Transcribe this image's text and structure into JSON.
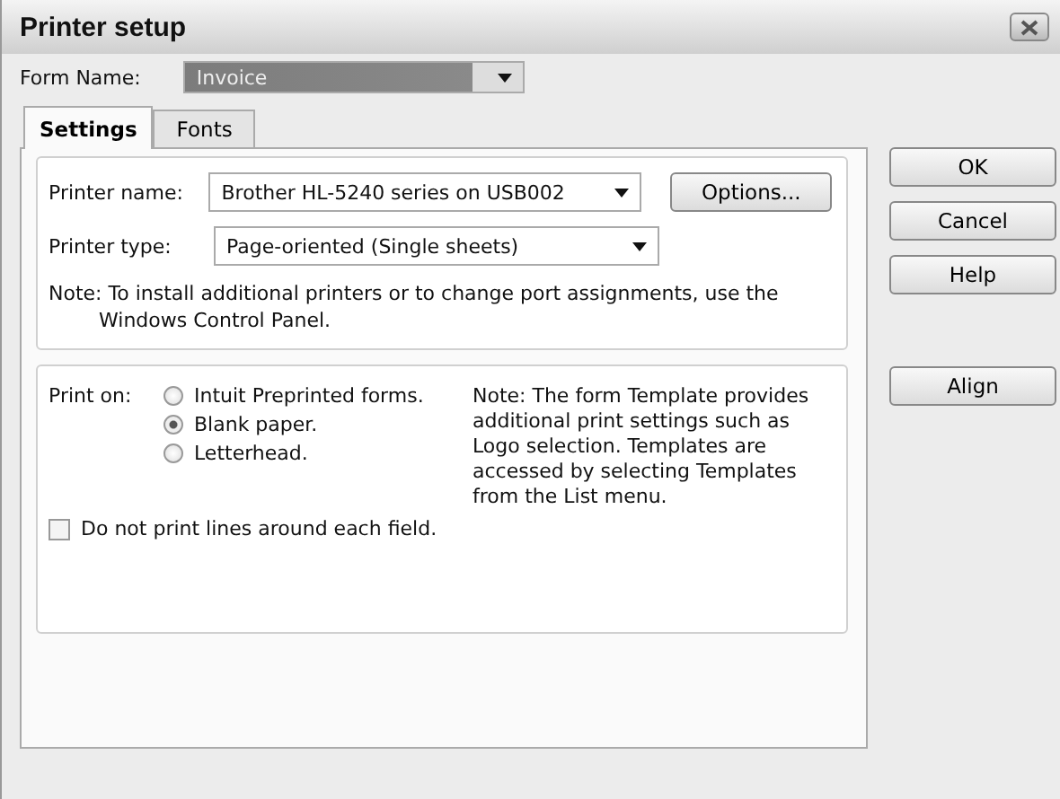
{
  "window": {
    "title": "Printer setup"
  },
  "form_name": {
    "label": "Form Name:",
    "value": "Invoice"
  },
  "tabs": [
    {
      "label": "Settings",
      "selected": true
    },
    {
      "label": "Fonts",
      "selected": false
    }
  ],
  "printer_name": {
    "label": "Printer name:",
    "value": "Brother HL-5240 series on USB002"
  },
  "options_button": "Options...",
  "printer_type": {
    "label": "Printer type:",
    "value": "Page-oriented (Single sheets)"
  },
  "printer_note": "Note: To install additional printers or to change port assignments, use the Windows Control Panel.",
  "print_on": {
    "label": "Print on:",
    "options": [
      {
        "label": "Intuit Preprinted forms.",
        "selected": false
      },
      {
        "label": "Blank paper.",
        "selected": true
      },
      {
        "label": "Letterhead.",
        "selected": false
      }
    ]
  },
  "template_note": "Note: The form Template provides additional print settings such as Logo selection.  Templates are accessed by selecting Templates from the List menu.",
  "no_lines": {
    "label": "Do not print lines around each field.",
    "checked": false
  },
  "buttons": [
    "OK",
    "Cancel",
    "Help"
  ],
  "align_button": "Align"
}
